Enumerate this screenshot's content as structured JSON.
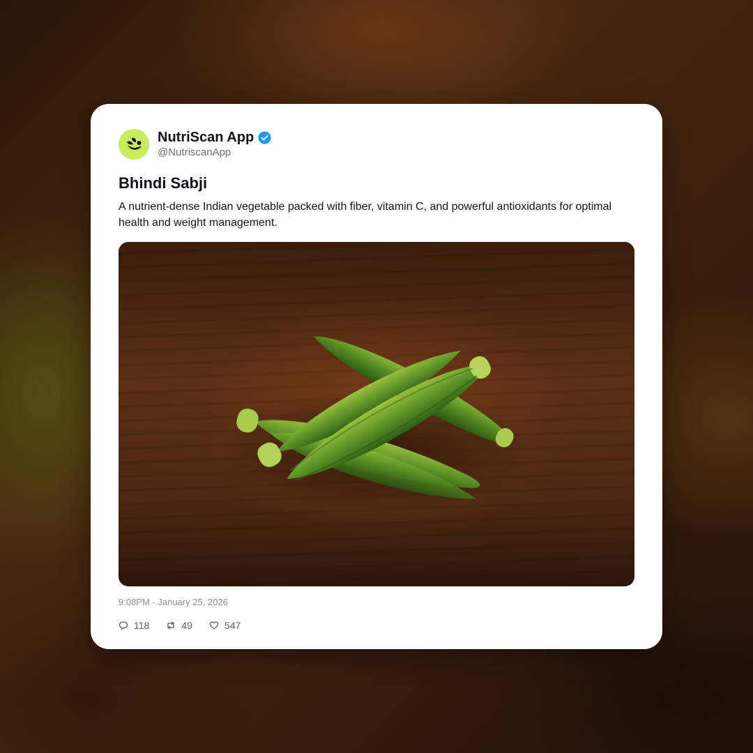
{
  "post": {
    "display_name": "NutriScan App",
    "handle": "@NutriscanApp",
    "verified": true,
    "title": "Bhindi Sabji",
    "description": "A nutrient-dense Indian vegetable packed with fiber, vitamin C, and powerful antioxidants for optimal health and weight management.",
    "image_alt": "Okra pods on a wooden table",
    "timestamp": "9:08PM - January 25, 2026",
    "stats": {
      "replies": "118",
      "reposts": "49",
      "likes": "547"
    }
  },
  "icons": {
    "avatar": "nutriscan-logo-icon",
    "verified": "verified-badge-icon",
    "replies": "comment-icon",
    "reposts": "repost-icon",
    "likes": "heart-icon"
  },
  "colors": {
    "avatar_bg": "#c9ec5a",
    "verified_blue": "#1d9bf0",
    "text_primary": "#0f1419",
    "text_secondary": "#6b7075"
  }
}
